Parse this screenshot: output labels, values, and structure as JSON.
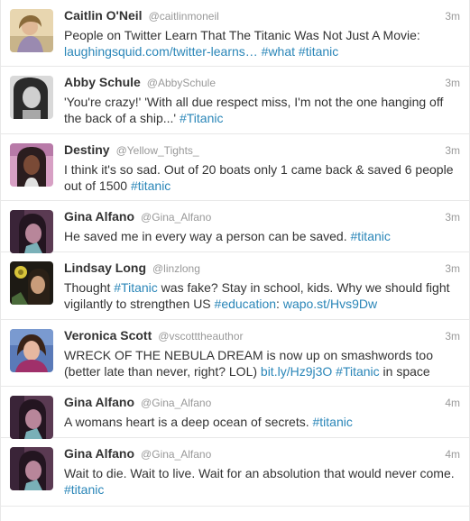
{
  "colors": {
    "link": "#2a86b8",
    "muted": "#999999",
    "text": "#333333",
    "divider": "#e8e8e8"
  },
  "tweets": [
    {
      "name": "Caitlin O'Neil",
      "handle": "@caitlinmoneil",
      "time": "3m",
      "avatar": "avatar-caitlin",
      "text": [
        {
          "t": "People on Twitter Learn That The Titanic Was Not Just A Movie: "
        },
        {
          "t": "laughingsquid.com/twitter-learns…",
          "link": true
        },
        {
          "t": " "
        },
        {
          "t": "#what",
          "link": true
        },
        {
          "t": " "
        },
        {
          "t": "#titanic",
          "link": true
        }
      ]
    },
    {
      "name": "Abby Schule",
      "handle": "@AbbySchule",
      "time": "3m",
      "avatar": "avatar-abby",
      "text": [
        {
          "t": "'You're crazy!' 'With all due respect miss, I'm not the one hanging off the back of a ship...' "
        },
        {
          "t": "#Titanic",
          "link": true
        }
      ]
    },
    {
      "name": "Destiny",
      "handle": "@Yellow_Tights_",
      "time": "3m",
      "avatar": "avatar-destiny",
      "text": [
        {
          "t": "I think it's so sad. Out of 20 boats only 1 came back & saved 6 people out of 1500 "
        },
        {
          "t": "#titanic",
          "link": true
        }
      ]
    },
    {
      "name": "Gina Alfano",
      "handle": "@Gina_Alfano",
      "time": "3m",
      "avatar": "avatar-gina",
      "text": [
        {
          "t": "He saved me in every way a person can be saved. "
        },
        {
          "t": "#titanic",
          "link": true
        }
      ]
    },
    {
      "name": "Lindsay Long",
      "handle": "@linzlong",
      "time": "3m",
      "avatar": "avatar-lindsay",
      "text": [
        {
          "t": "Thought "
        },
        {
          "t": "#Titanic",
          "link": true
        },
        {
          "t": " was fake? Stay in school, kids. Why we should fight vigilantly to strengthen US "
        },
        {
          "t": "#education",
          "link": true
        },
        {
          "t": ": "
        },
        {
          "t": "wapo.st/Hvs9Dw",
          "link": true
        }
      ]
    },
    {
      "name": "Veronica Scott",
      "handle": "@vscotttheauthor",
      "time": "3m",
      "avatar": "avatar-veronica",
      "text": [
        {
          "t": "WRECK OF THE NEBULA DREAM is now up on smashwords too (better late than never, right? LOL) "
        },
        {
          "t": "bit.ly/Hz9j3O",
          "link": true
        },
        {
          "t": " "
        },
        {
          "t": "#Titanic",
          "link": true
        },
        {
          "t": " in space"
        }
      ]
    },
    {
      "name": "Gina Alfano",
      "handle": "@Gina_Alfano",
      "time": "4m",
      "avatar": "avatar-gina",
      "text": [
        {
          "t": "A womans heart is a deep ocean of secrets. "
        },
        {
          "t": "#titanic",
          "link": true
        }
      ]
    },
    {
      "name": "Gina Alfano",
      "handle": "@Gina_Alfano",
      "time": "4m",
      "avatar": "avatar-gina",
      "text": [
        {
          "t": "Wait to die. Wait to live. Wait for an absolution that would never come. "
        },
        {
          "t": "#titanic",
          "link": true
        }
      ]
    }
  ]
}
